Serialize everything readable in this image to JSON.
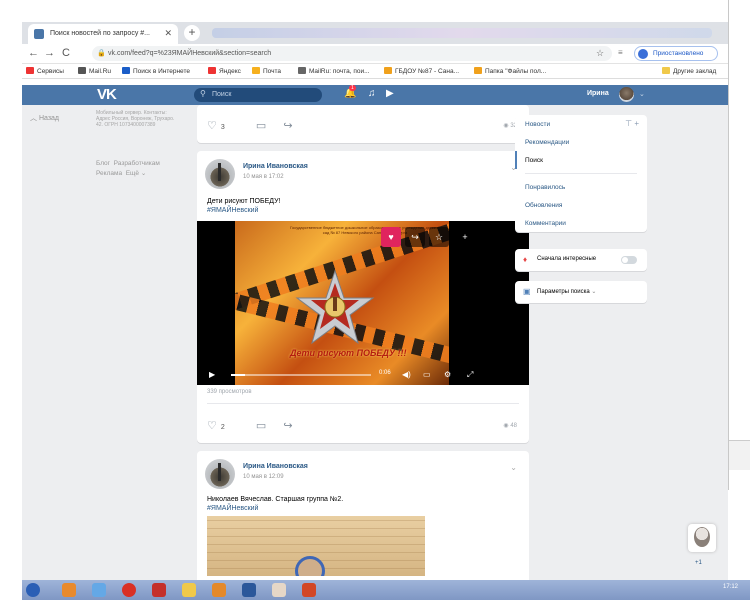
{
  "browser": {
    "tab_title": "Поиск новостей по запросу #...",
    "tab_close": "✕",
    "new_tab": "+",
    "url": "vk.com/feed?q=%23ЯМАЙНевский&section=search",
    "profile_label": "Приостановлено",
    "bookmarks": [
      "Сервисы",
      "Mail.Ru",
      "Поиск в Интернете",
      "Яндекс",
      "Почта",
      "MailRu: почта, пои...",
      "ГБДОУ №87 - Сана...",
      "Папка \"Файлы пол...",
      "Другие заклад"
    ]
  },
  "vk": {
    "search_placeholder": "Поиск",
    "notif_badge": "1",
    "user_name": "Ирина",
    "left_back": "Назад",
    "left_tiny": "Мобильный сервер. Контакты: Адрес Россия, Воронеж, Трухаро. 42. ОГРН 1073400007389",
    "footer_links": [
      "Блог",
      "Разработчикам",
      "Реклама",
      "Ещё"
    ]
  },
  "posts": [
    {
      "likes": "3",
      "views": "32"
    },
    {
      "author": "Ирина Ивановская",
      "date": "10 мая в 17:02",
      "text": "Дети рисуют ПОБЕДУ!",
      "tag": "#ЯМАЙНевский",
      "video_caption": "Дети рисуют ПОБЕДУ !!!",
      "video_title": "Государственное бюджетное дошкольное образовательное учреждение детский сад № 87 Невского района Санкт-Петербурга",
      "video_time": "0:06",
      "video_views": "339 просмотров",
      "likes": "2",
      "views": "48"
    },
    {
      "author": "Ирина Ивановская",
      "date": "10 мая в 12:09",
      "text": "Николаев Вячеслав. Старшая группа №2.",
      "tag": "#ЯМАЙНевский"
    }
  ],
  "right_menu": {
    "items": [
      "Новости",
      "Рекомендации",
      "Поиск",
      "Понравилось",
      "Обновления",
      "Комментарии"
    ],
    "interesting_first": "Сначала интересные",
    "search_params": "Параметры поиска"
  },
  "taskbar": {
    "time": "17:12"
  },
  "floating": {
    "count": "+1"
  }
}
